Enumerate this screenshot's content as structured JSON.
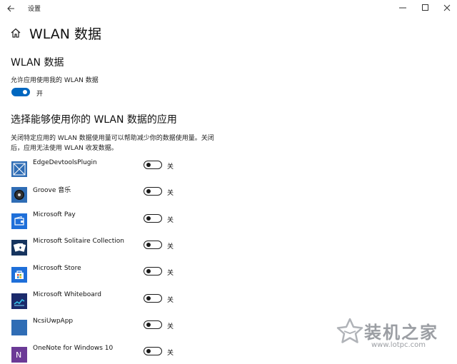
{
  "window": {
    "title": "设置",
    "controls": [
      "minimize",
      "maximize",
      "close"
    ]
  },
  "header": {
    "page_title": "WLAN 数据"
  },
  "section_wlan": {
    "title": "WLAN 数据",
    "setting_label": "允许应用使用我的 WLAN 数据",
    "toggle_state": "on",
    "toggle_label": "开"
  },
  "section_apps": {
    "title": "选择能够使用你的 WLAN 数据的应用",
    "description_line1": "关闭特定应用的 WLAN 数据使用量可以帮助减少你的数据使用量。关闭",
    "description_line2": "后，应用无法使用 WLAN 收发数据。",
    "apps": [
      {
        "name": "EdgeDevtoolsPlugin",
        "toggle_label": "关",
        "icon": "edge-devtools-icon",
        "icon_color": "#2f6db5"
      },
      {
        "name": "Groove 音乐",
        "toggle_label": "关",
        "icon": "groove-music-icon",
        "icon_color": "#2f6db5"
      },
      {
        "name": "Microsoft Pay",
        "toggle_label": "关",
        "icon": "wallet-icon",
        "icon_color": "#1e6fd9"
      },
      {
        "name": "Microsoft Solitaire Collection",
        "toggle_label": "关",
        "icon": "solitaire-cards-icon",
        "icon_color": "#16345e"
      },
      {
        "name": "Microsoft Store",
        "toggle_label": "关",
        "icon": "store-bag-icon",
        "icon_color": "#1e6fd9"
      },
      {
        "name": "Microsoft Whiteboard",
        "toggle_label": "关",
        "icon": "whiteboard-icon",
        "icon_color": "#1b2a6b"
      },
      {
        "name": "NcsiUwpApp",
        "toggle_label": "关",
        "icon": "ncsi-app-icon",
        "icon_color": "#2f6db5"
      },
      {
        "name": "OneNote for Windows 10",
        "toggle_label": "关",
        "icon": "onenote-icon",
        "icon_color": "#6b3a96"
      }
    ]
  },
  "watermark": {
    "text": "装机之家",
    "url": "www.lotpc.com"
  },
  "colors": {
    "accent": "#0067c0",
    "toggle_off_border": "#1a1a1a"
  }
}
